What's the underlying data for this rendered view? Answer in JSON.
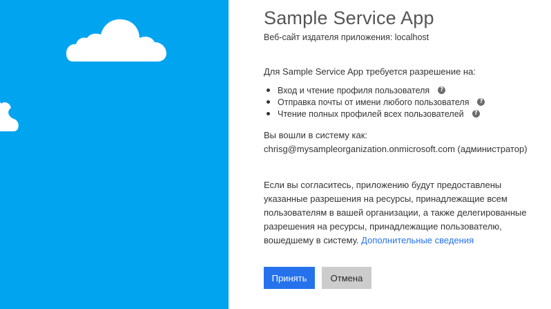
{
  "app": {
    "title": "Sample Service App",
    "publisher_line": "Веб-сайт издателя приложения: localhost"
  },
  "permissions": {
    "heading": "Для Sample Service App требуется разрешение на:",
    "items": [
      {
        "label": "Вход и чтение профиля пользователя",
        "help_icon": "question-circle-icon"
      },
      {
        "label": "Отправка почты от имени любого пользователя",
        "help_icon": "question-circle-icon"
      },
      {
        "label": "Чтение полных профилей всех пользователей",
        "help_icon": "question-circle-icon"
      }
    ],
    "help_glyph": "?"
  },
  "account": {
    "signed_in_label": "Вы вошли в систему как:",
    "user": "chrisg@mysampleorganization.onmicrosoft.com (администратор)"
  },
  "consent": {
    "lines": [
      "Если вы согласитесь, приложению будут предоставлены",
      "указанные разрешения на ресурсы, принадлежащие всем",
      "пользователям в вашей организации, а также делегированные",
      "разрешения на ресурсы, принадлежащие пользователю,"
    ],
    "last_line_text": "вошедшему в систему. ",
    "more_link": "Дополнительные сведения"
  },
  "buttons": {
    "accept": "Принять",
    "cancel": "Отмена"
  },
  "colors": {
    "left_panel": "#00a4ef",
    "accent": "#2672ec",
    "cancel_button": "#cccccc"
  }
}
